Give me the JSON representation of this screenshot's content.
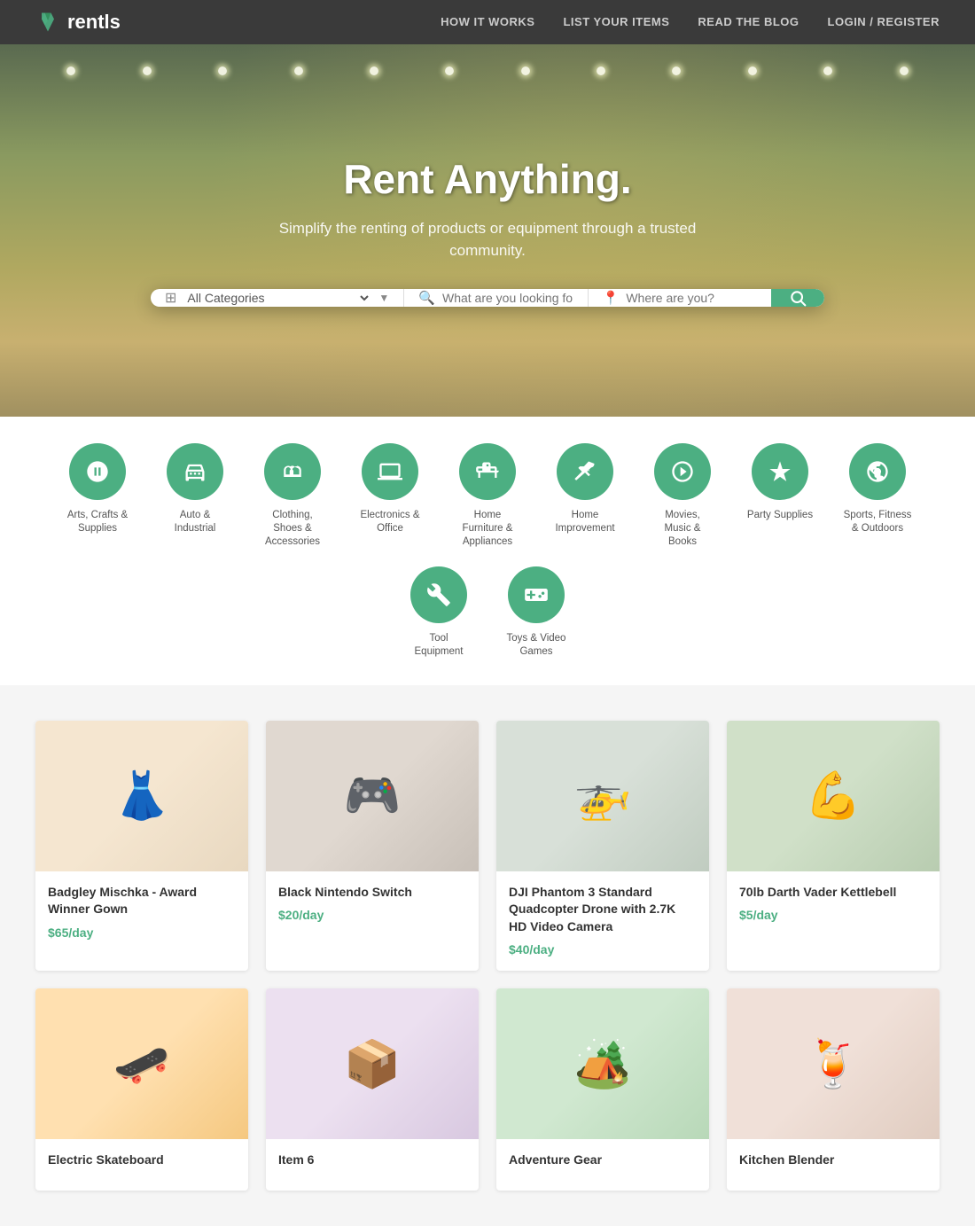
{
  "brand": {
    "name": "rentls",
    "logo_alt": "Rentls logo"
  },
  "navbar": {
    "links": [
      {
        "id": "how-it-works",
        "label": "HOW IT WORKS",
        "href": "#"
      },
      {
        "id": "list-your-items",
        "label": "LIST YOUR ITEMS",
        "href": "#"
      },
      {
        "id": "read-the-blog",
        "label": "READ THE BLOG",
        "href": "#"
      },
      {
        "id": "login-register",
        "label": "LOGIN / REGISTER",
        "href": "#"
      }
    ]
  },
  "hero": {
    "title": "Rent Anything.",
    "subtitle": "Simplify the renting of products or equipment through a trusted community."
  },
  "search": {
    "category_placeholder": "All Categories",
    "what_placeholder": "What are you looking for?",
    "where_placeholder": "Where are you?",
    "categories": [
      "All Categories",
      "Arts, Crafts & Supplies",
      "Auto & Industrial",
      "Clothing, Shoes & Accessories",
      "Electronics & Office",
      "Home Furniture & Appliances",
      "Home Improvement",
      "Movies, Music & Books",
      "Party Supplies",
      "Sports, Fitness & Outdoors",
      "Tool Equipment",
      "Toys & Video Games"
    ]
  },
  "categories": [
    {
      "id": "arts-crafts",
      "label": "Arts, Crafts &\nSupplies",
      "icon": "🎨"
    },
    {
      "id": "auto-industrial",
      "label": "Auto &\nIndustrial",
      "icon": "🚗"
    },
    {
      "id": "clothing",
      "label": "Clothing,\nShoes &\nAccessories",
      "icon": "👗"
    },
    {
      "id": "electronics",
      "label": "Electronics &\nOffice",
      "icon": "💻"
    },
    {
      "id": "home-furniture",
      "label": "Home\nFurniture &\nAppliances",
      "icon": "🛋️"
    },
    {
      "id": "home-improvement",
      "label": "Home\nImprovement",
      "icon": "🔨"
    },
    {
      "id": "movies-music",
      "label": "Movies,\nMusic &\nBooks",
      "icon": "🎬"
    },
    {
      "id": "party-supplies",
      "label": "Party Supplies",
      "icon": "🎉"
    },
    {
      "id": "sports-fitness",
      "label": "Sports, Fitness\n& Outdoors",
      "icon": "⚽"
    },
    {
      "id": "tool-equipment",
      "label": "Tool\nEquipment",
      "icon": "🔧"
    },
    {
      "id": "toys-games",
      "label": "Toys & Video\nGames",
      "icon": "🎮"
    }
  ],
  "products": [
    {
      "id": "p1",
      "name": "Badgley Mischka - Award Winner Gown",
      "price": "$65/day",
      "emoji": "👗",
      "bg": "#f0e8d8"
    },
    {
      "id": "p2",
      "name": "Black Nintendo Switch",
      "price": "$20/day",
      "emoji": "🎮",
      "bg": "#e8e0d8"
    },
    {
      "id": "p3",
      "name": "DJI Phantom 3 Standard Quadcopter Drone with 2.7K HD Video Camera",
      "price": "$40/day",
      "emoji": "🚁",
      "bg": "#dde8dd"
    },
    {
      "id": "p4",
      "name": "70lb Darth Vader Kettlebell",
      "price": "$5/day",
      "emoji": "💪",
      "bg": "#d8e8d0"
    },
    {
      "id": "p5",
      "name": "Electric Skateboard",
      "price": "",
      "emoji": "🛹",
      "bg": "#ffe0b0"
    },
    {
      "id": "p6",
      "name": "Item 6",
      "price": "",
      "emoji": "📦",
      "bg": "#e8e0f0"
    },
    {
      "id": "p7",
      "name": "Adventure Gear",
      "price": "",
      "emoji": "🏕️",
      "bg": "#d0e8d0"
    },
    {
      "id": "p8",
      "name": "Kitchen Blender",
      "price": "",
      "emoji": "🍹",
      "bg": "#f0e0d8"
    }
  ]
}
